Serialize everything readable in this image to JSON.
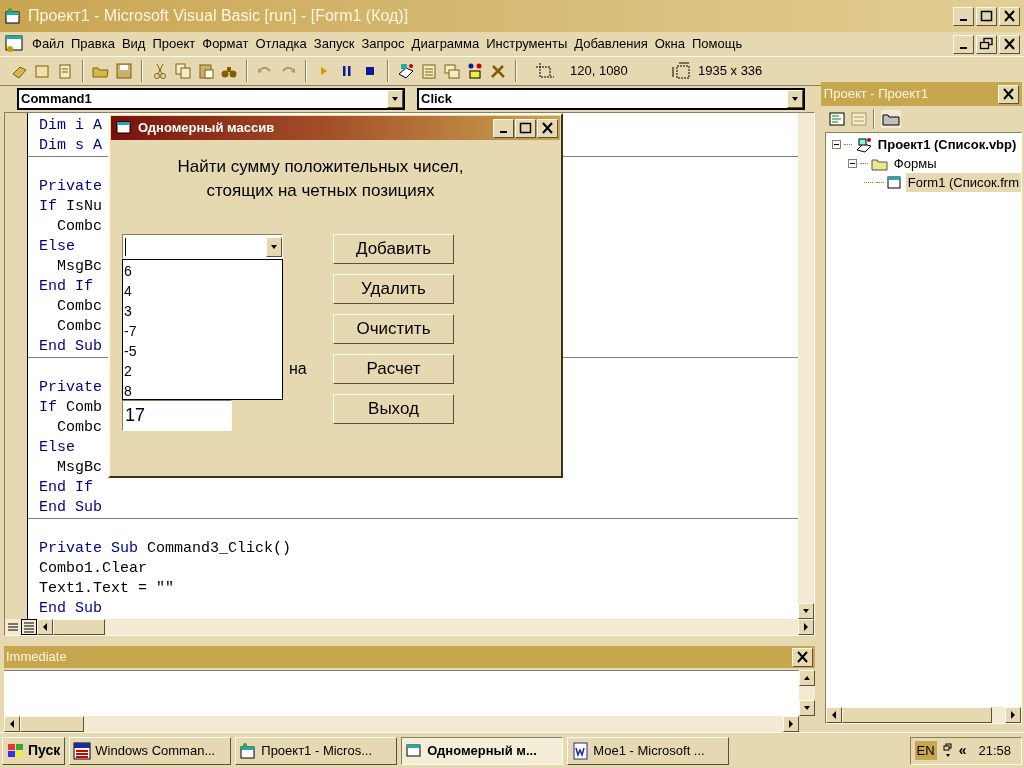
{
  "window": {
    "title": "Проект1 - Microsoft Visual Basic [run] - [Form1 (Код)]"
  },
  "menu": [
    "Файл",
    "Правка",
    "Вид",
    "Проект",
    "Формат",
    "Отладка",
    "Запуск",
    "Запрос",
    "Диаграмма",
    "Инструменты",
    "Добавления",
    "Окна",
    "Помощь"
  ],
  "toolbar": {
    "position": "120, 1080",
    "size": "1935 x 336"
  },
  "code_window": {
    "object_combo": "Command1",
    "procedure_combo": "Click",
    "procedures": [
      [
        [
          {
            "text": "Dim i A",
            "keyword": true
          }
        ],
        [
          {
            "text": "Dim s A",
            "keyword": true
          }
        ]
      ],
      [
        [
          {
            "text": "Private",
            "keyword": true
          }
        ],
        [
          {
            "text": "If ",
            "keyword": true
          },
          {
            "text": "IsNu",
            "keyword": false
          }
        ],
        [
          {
            "text": "  Combc",
            "keyword": false
          }
        ],
        [
          {
            "text": "Else",
            "keyword": true
          }
        ],
        [
          {
            "text": "  MsgBc",
            "keyword": false
          }
        ],
        [
          {
            "text": "End If",
            "keyword": true
          }
        ],
        [
          {
            "text": "  Combc",
            "keyword": false
          }
        ],
        [
          {
            "text": "  Combc",
            "keyword": false
          }
        ],
        [
          {
            "text": "End Sub",
            "keyword": true
          }
        ]
      ],
      [
        [
          {
            "text": "Private",
            "keyword": true
          }
        ],
        [
          {
            "text": "If ",
            "keyword": true
          },
          {
            "text": "Comb",
            "keyword": false
          }
        ],
        [
          {
            "text": "  Combc",
            "keyword": false
          }
        ],
        [
          {
            "text": "Else",
            "keyword": true
          }
        ],
        [
          {
            "text": "  MsgBc",
            "keyword": false
          }
        ],
        [
          {
            "text": "End If",
            "keyword": true
          }
        ],
        [
          {
            "text": "End Sub",
            "keyword": true
          }
        ]
      ],
      [
        [
          {
            "text": "Private Sub ",
            "keyword": true
          },
          {
            "text": "Command3_Click()",
            "keyword": false
          }
        ],
        [
          {
            "text": "Combo1.Clear",
            "keyword": false
          }
        ],
        [
          {
            "text": "Text1.Text = \"\"",
            "keyword": false
          }
        ],
        [
          {
            "text": "End Sub",
            "keyword": true
          }
        ]
      ]
    ]
  },
  "form_window": {
    "title": "Одномерный массив",
    "prompt_lines": [
      "Найти сумму положительных чисел,",
      "стоящих на четных позициях"
    ],
    "combo_list": [
      "6",
      "4",
      "3",
      "-7",
      "-5",
      "2",
      "8"
    ],
    "label_fragment": "на",
    "result": "17",
    "buttons": [
      "Добавить",
      "Удалить",
      "Очистить",
      "Расчет",
      "Выход"
    ]
  },
  "immediate": {
    "title": "Immediate"
  },
  "project_pane": {
    "title": "Проект - Проект1",
    "tree": [
      {
        "label": "Проект1 (Список.vbp)",
        "kind": "project",
        "expanded": true,
        "selected": false,
        "children": [
          {
            "label": "Формы",
            "kind": "folder",
            "expanded": true,
            "selected": false,
            "children": [
              {
                "label": "Form1 (Список.frm",
                "kind": "form",
                "selected": true
              }
            ]
          }
        ]
      }
    ]
  },
  "taskbar": {
    "start": "Пуск",
    "tasks": [
      {
        "label": "Windows Comman...",
        "kind": "dos",
        "selected": false
      },
      {
        "label": "Проект1 - Micros...",
        "kind": "vb",
        "selected": false
      },
      {
        "label": "Одномерный м...",
        "kind": "form",
        "selected": true
      },
      {
        "label": "Мое1 - Microsoft ...",
        "kind": "word",
        "selected": false
      }
    ],
    "language": "EN",
    "tray_chevron": "«",
    "clock": "21:58"
  }
}
